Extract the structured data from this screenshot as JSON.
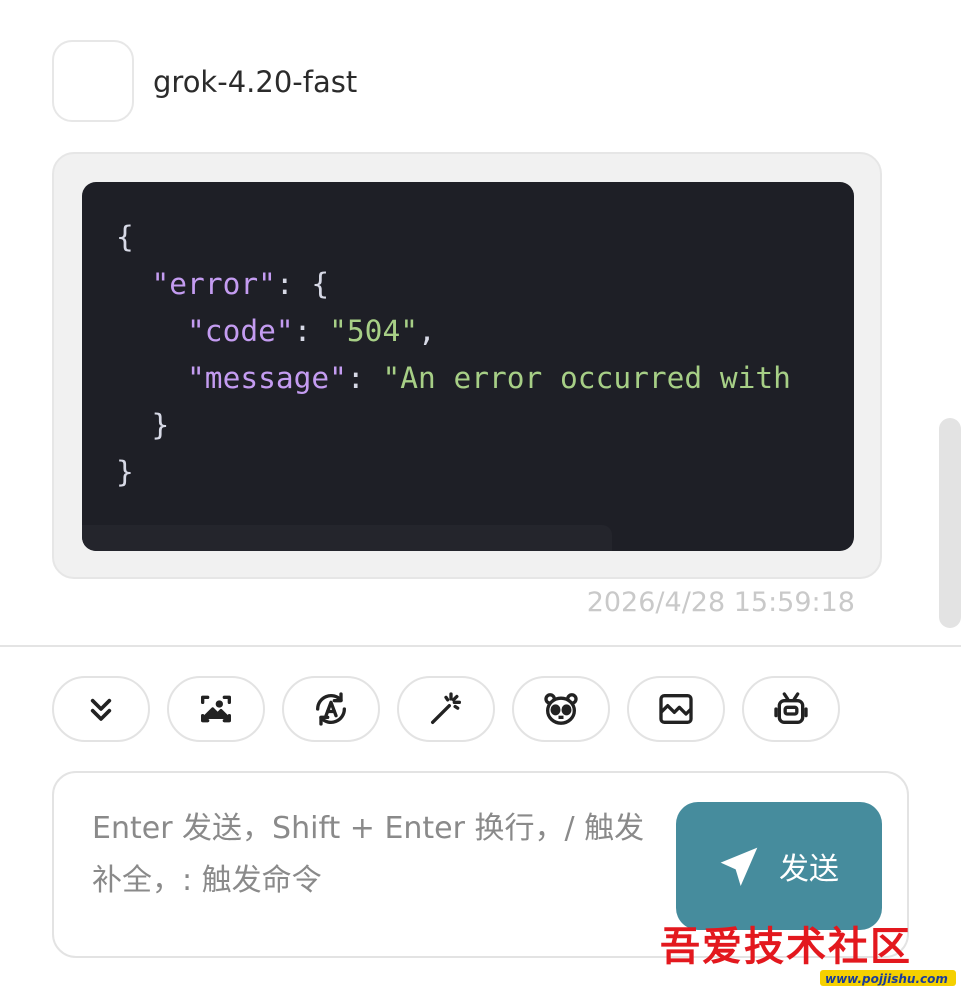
{
  "message": {
    "model_name": "grok-4.20-fast",
    "timestamp": "2026/4/28 15:59:18",
    "code": {
      "open_brace": "{",
      "error_key": "\"error\"",
      "colon": ": ",
      "error_open": "{",
      "code_key": "\"code\"",
      "code_value": "\"504\"",
      "comma": ",",
      "message_key": "\"message\"",
      "message_value": "\"An error occurred with",
      "inner_close": "}",
      "outer_close": "}"
    }
  },
  "toolbar": {
    "buttons": [
      {
        "icon": "double-chevron-down-icon"
      },
      {
        "icon": "image-scan-icon"
      },
      {
        "icon": "auto-mode-icon"
      },
      {
        "icon": "magic-wand-icon"
      },
      {
        "icon": "mask-face-icon"
      },
      {
        "icon": "image-frame-icon"
      },
      {
        "icon": "robot-icon"
      }
    ]
  },
  "input": {
    "placeholder": "Enter 发送，Shift + Enter 换行，/ 触发补全，: 触发命令",
    "value": ""
  },
  "send_button": {
    "label": "发送",
    "icon": "send-arrow-icon"
  },
  "watermark": {
    "text": "吾爱技术社区",
    "url": "www.pojjishu.com"
  },
  "colors": {
    "accent": "#468c9d",
    "code_bg": "#1e1f26",
    "code_key": "#c49cf1",
    "code_string": "#a7cf86"
  }
}
